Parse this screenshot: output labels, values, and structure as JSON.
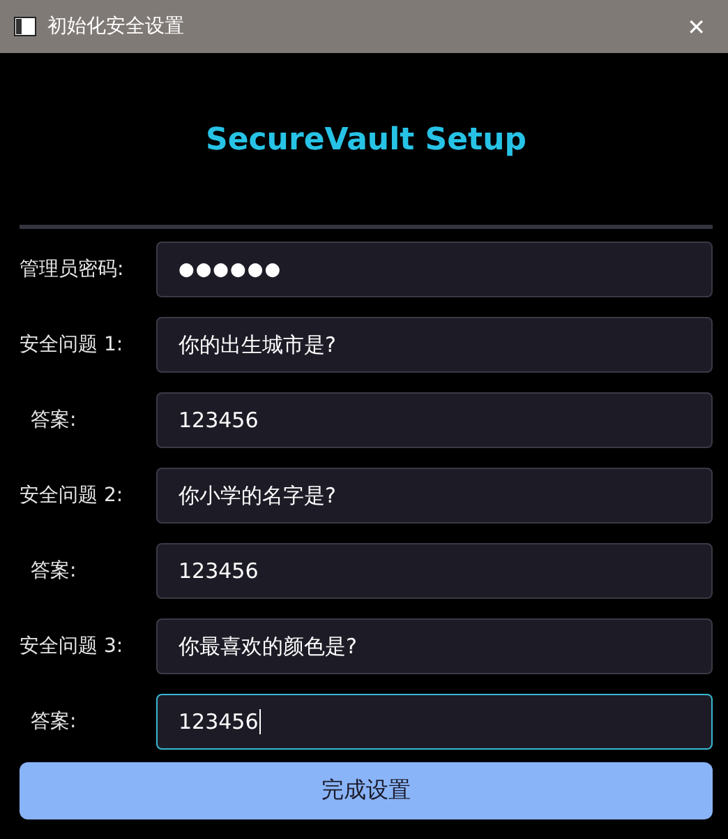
{
  "window": {
    "title": "初始化安全设置",
    "close": "✕"
  },
  "heading": "SecureVault Setup",
  "rows": [
    {
      "kind": "password",
      "label": "管理员密码:",
      "value": "●●●●●●",
      "focused": false
    },
    {
      "kind": "question",
      "label": "安全问题 1:",
      "value": "你的出生城市是?",
      "focused": false
    },
    {
      "kind": "answer",
      "label": "答案:",
      "value": "123456",
      "focused": false
    },
    {
      "kind": "question",
      "label": "安全问题 2:",
      "value": "你小学的名字是?",
      "focused": false
    },
    {
      "kind": "answer",
      "label": "答案:",
      "value": "123456",
      "focused": false
    },
    {
      "kind": "question",
      "label": "安全问题 3:",
      "value": "你最喜欢的颜色是?",
      "focused": false
    },
    {
      "kind": "answer",
      "label": "答案:",
      "value": "123456",
      "focused": true
    }
  ],
  "button": "完成设置"
}
